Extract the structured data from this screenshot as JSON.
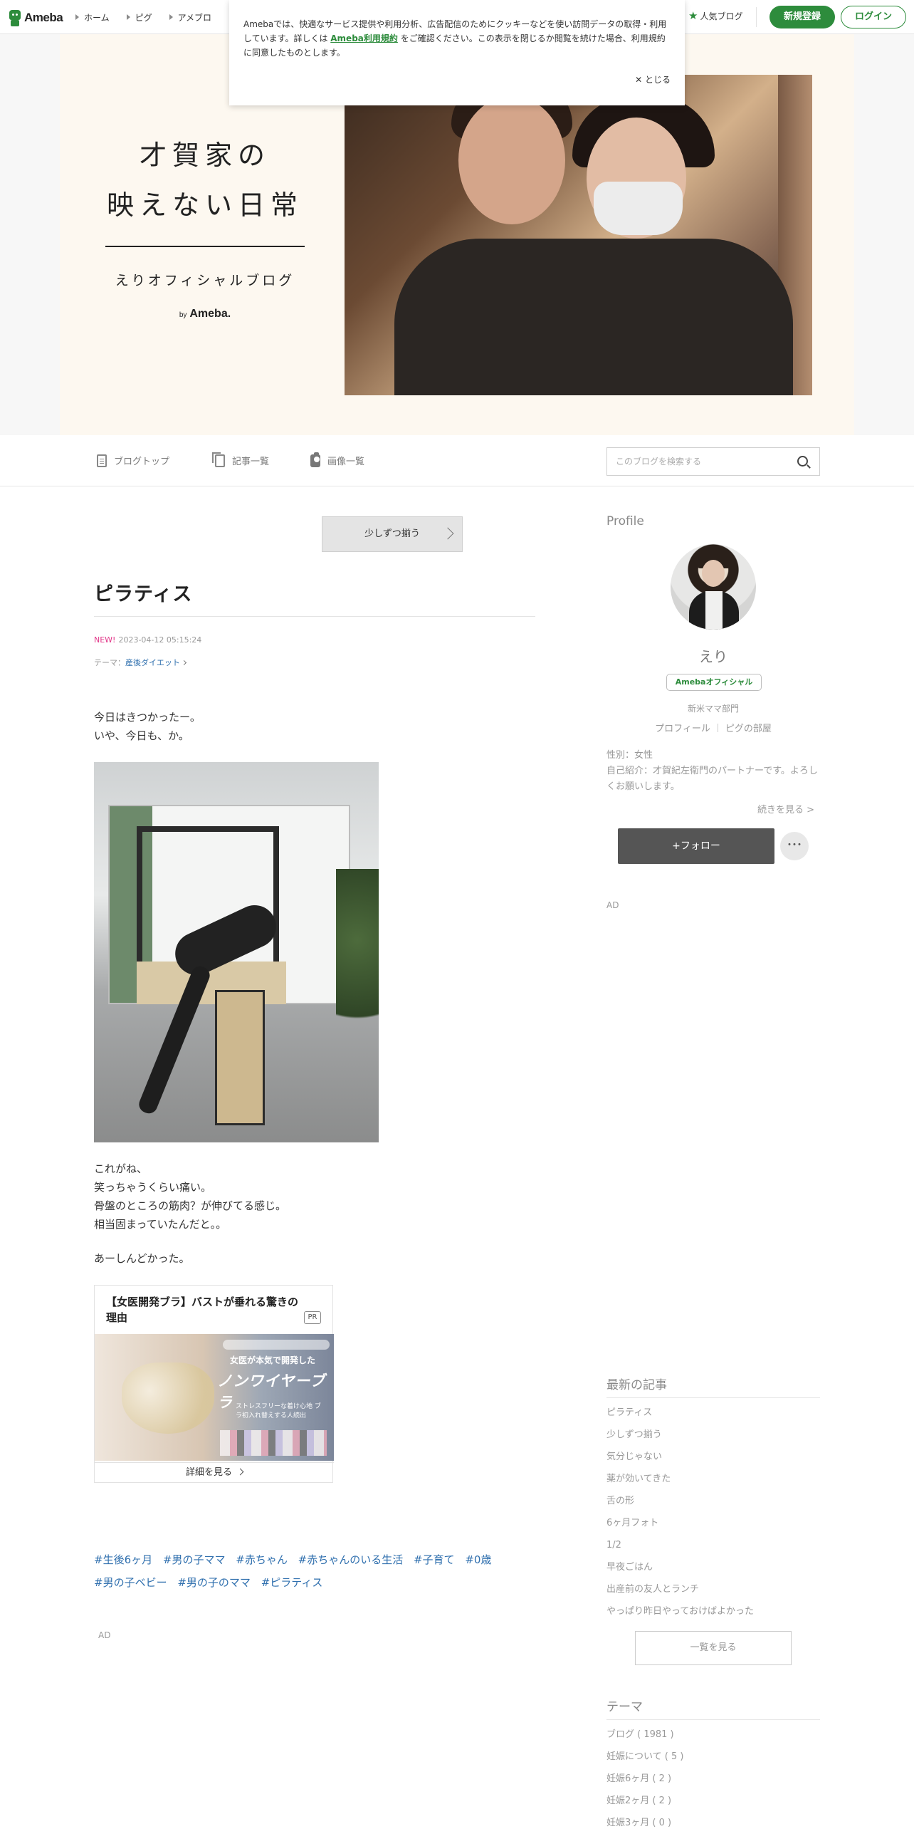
{
  "topbar": {
    "logo_text": "Ameba",
    "nav": [
      "ホーム",
      "ピグ",
      "アメブロ"
    ],
    "popular_label": "人気ブログ",
    "register_label": "新規登録",
    "login_label": "ログイン"
  },
  "cookie_notice": {
    "text_before": "Amebaでは、快適なサービス提供や利用分析、広告配信のためにクッキーなどを使い訪問データの取得・利用しています。詳しくは ",
    "link_text": "Ameba利用規約",
    "text_after": " をご確認ください。この表示を閉じるか閲覧を続けた場合、利用規約に同意したものとします。",
    "close_label": "✕ とじる"
  },
  "header": {
    "title_line1": "才賀家の",
    "title_line2": "映えない日常",
    "subtitle": "えりオフィシャルブログ",
    "by_prefix": "by",
    "by_brand": "Ameba."
  },
  "blog_nav": {
    "items": [
      "ブログトップ",
      "記事一覧",
      "画像一覧"
    ],
    "search_placeholder": "このブログを検索する"
  },
  "article": {
    "prev_label": "少しずつ揃う",
    "title": "ピラティス",
    "new_label": "NEW!",
    "date": "2023-04-12 05:15:24",
    "theme_prefix": "テーマ：",
    "theme_name": "産後ダイエット",
    "paragraph1": [
      "今日はきつかったー。",
      "いや、今日も、か。"
    ],
    "paragraph2": [
      "これがね、",
      "笑っちゃうくらい痛い。",
      "骨盤のところの筋肉？が伸びてる感じ。",
      "相当固まっていたんだと。。"
    ],
    "paragraph3": [
      "あーしんどかった。"
    ],
    "hashtags": [
      "#生後6ヶ月",
      "#男の子ママ",
      "#赤ちゃん",
      "#赤ちゃんのいる生活",
      "#子育て",
      "#0歳",
      "#男の子ベビー",
      "#男の子のママ",
      "#ピラティス"
    ],
    "ad_label": "AD"
  },
  "ad_card": {
    "title": "【女医開発ブラ】バストが垂れる驚きの理由",
    "pr": "PR",
    "img_line1": "女医が本気で開発した",
    "img_line2": "ノンワイヤーブラ",
    "img_line3": "ストレスフリーな着け心地 ブラ初入れ替えする人続出",
    "more_label": "詳細を見る"
  },
  "sidebar": {
    "profile_heading": "Profile",
    "name": "えり",
    "badge": "Amebaオフィシャル",
    "category": "新米ママ部門",
    "links": [
      "プロフィール",
      "ピグの部屋"
    ],
    "gender": "性別：女性",
    "intro": "自己紹介：才賀紀左衛門のパートナーです。よろしくお願いします。",
    "read_more": "続きを見る >",
    "follow_label": "+フォロー",
    "more_label": "･･･",
    "ad_label": "AD",
    "recent_heading": "最新の記事",
    "recent": [
      "ピラティス",
      "少しずつ揃う",
      "気分じゃない",
      "薬が効いてきた",
      "舌の形",
      "6ヶ月フォト",
      "1/2",
      "早夜ごはん",
      "出産前の友人とランチ",
      "やっぱり昨日やっておけばよかった"
    ],
    "list_all": "一覧を見る",
    "theme_heading": "テーマ",
    "themes": [
      "ブログ ( 1981 )",
      "妊娠について ( 5 )",
      "妊娠6ヶ月 ( 2 )",
      "妊娠2ヶ月 ( 2 )",
      "妊娠3ヶ月 ( 0 )"
    ]
  },
  "colors": {
    "brand_green": "#2d8c3c",
    "link_blue": "#2f6fae",
    "new_pink": "#e2388a"
  }
}
